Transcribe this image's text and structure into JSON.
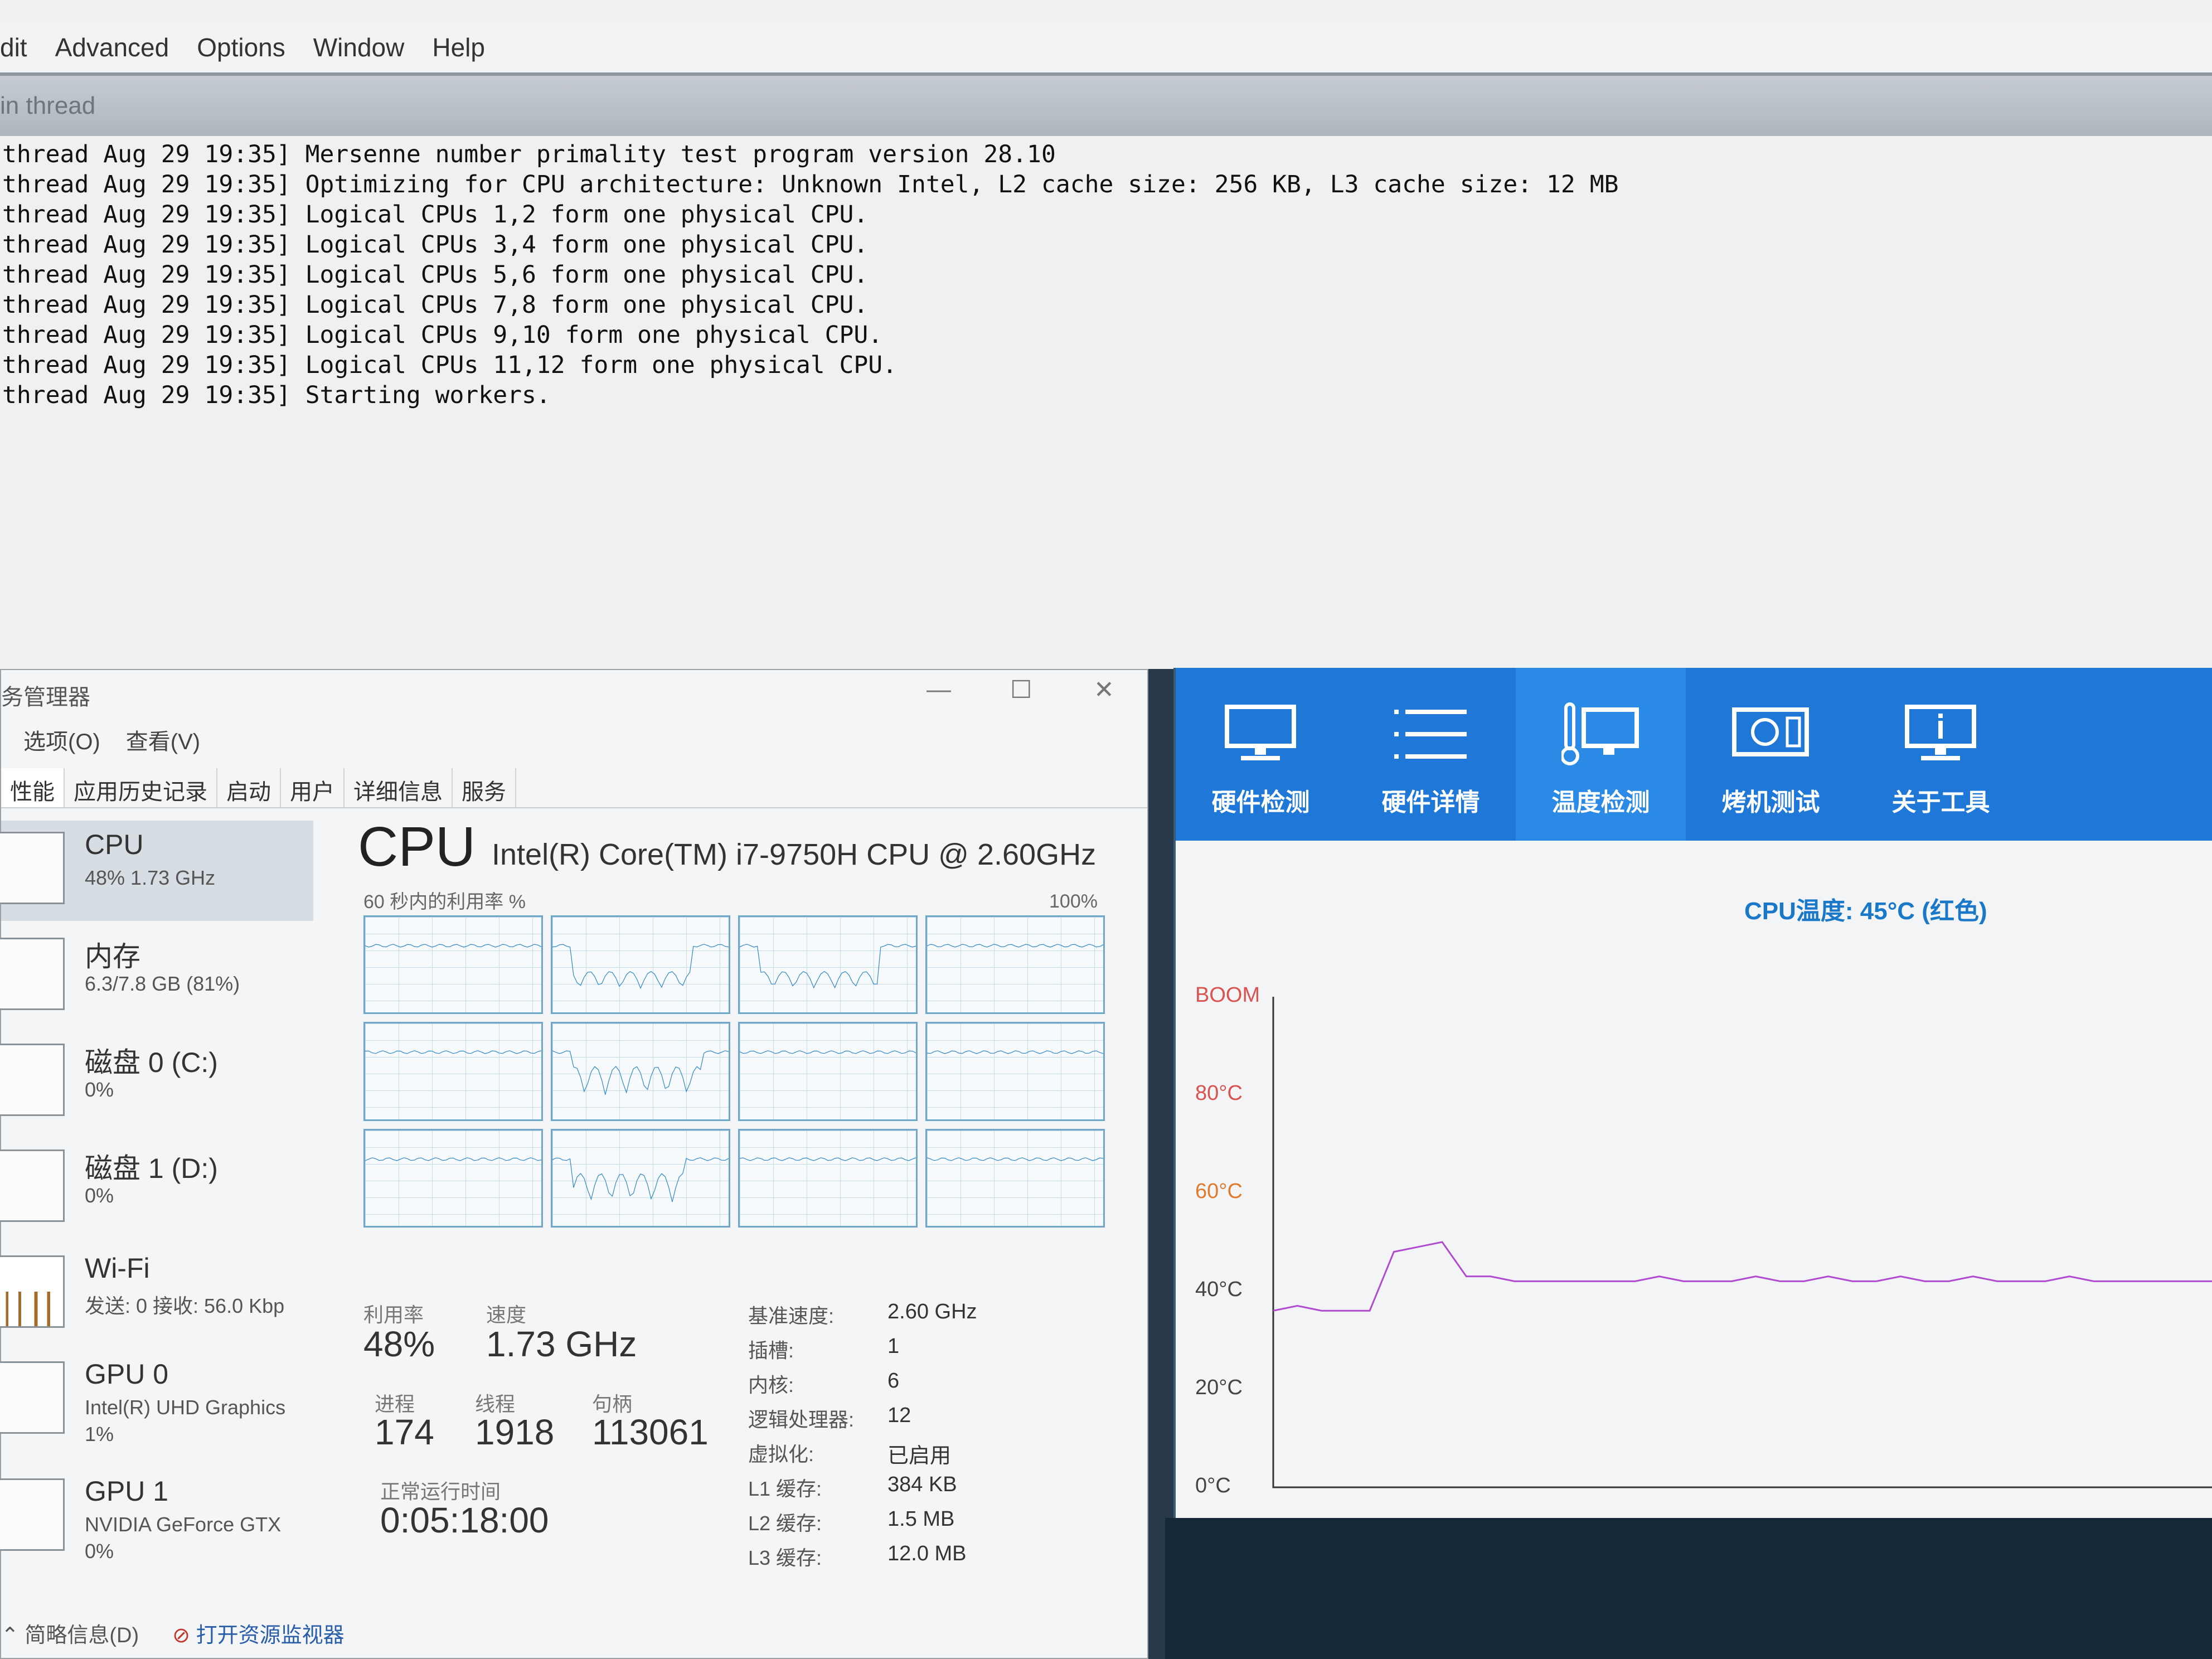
{
  "prime95": {
    "menu": [
      "dit",
      "Advanced",
      "Options",
      "Window",
      "Help"
    ],
    "window_title": "in thread",
    "log": [
      "thread Aug 29 19:35] Mersenne number primality test program version 28.10",
      "thread Aug 29 19:35] Optimizing for CPU architecture: Unknown Intel, L2 cache size: 256 KB, L3 cache size: 12 MB",
      "thread Aug 29 19:35] Logical CPUs 1,2 form one physical CPU.",
      "thread Aug 29 19:35] Logical CPUs 3,4 form one physical CPU.",
      "thread Aug 29 19:35] Logical CPUs 5,6 form one physical CPU.",
      "thread Aug 29 19:35] Logical CPUs 7,8 form one physical CPU.",
      "thread Aug 29 19:35] Logical CPUs 9,10 form one physical CPU.",
      "thread Aug 29 19:35] Logical CPUs 11,12 form one physical CPU.",
      "thread Aug 29 19:35] Starting workers."
    ]
  },
  "taskmgr": {
    "title": "务管理器",
    "win_controls": {
      "minimize": "—",
      "maximize": "☐",
      "close": "✕"
    },
    "menus": [
      "选项(O)",
      "查看(V)"
    ],
    "tabs": [
      "性能",
      "应用历史记录",
      "启动",
      "用户",
      "详细信息",
      "服务"
    ],
    "sidebar": [
      {
        "name": "CPU",
        "sub": "48% 1.73 GHz",
        "sub2": ""
      },
      {
        "name": "内存",
        "sub": "6.3/7.8 GB (81%)",
        "sub2": ""
      },
      {
        "name": "磁盘 0 (C:)",
        "sub": "0%",
        "sub2": ""
      },
      {
        "name": "磁盘 1 (D:)",
        "sub": "0%",
        "sub2": ""
      },
      {
        "name": "Wi-Fi",
        "sub": "发送: 0 接收: 56.0 Kbp",
        "sub2": ""
      },
      {
        "name": "GPU 0",
        "sub": "Intel(R) UHD Graphics",
        "sub2": "1%"
      },
      {
        "name": "GPU 1",
        "sub": "NVIDIA GeForce GTX",
        "sub2": "0%"
      }
    ],
    "cpu_title": "CPU",
    "cpu_model": "Intel(R) Core(TM) i7-9750H CPU @ 2.60GHz",
    "util_label": "60 秒内的利用率 %",
    "util_max": "100%",
    "stats": {
      "util_label": "利用率",
      "util": "48%",
      "speed_label": "速度",
      "speed": "1.73 GHz",
      "proc_label": "进程",
      "proc": "174",
      "threads_label": "线程",
      "threads": "1918",
      "handles_label": "句柄",
      "handles": "113061",
      "uptime_label": "正常运行时间",
      "uptime": "0:05:18:00"
    },
    "specs": [
      {
        "k": "基准速度:",
        "v": "2.60 GHz"
      },
      {
        "k": "插槽:",
        "v": "1"
      },
      {
        "k": "内核:",
        "v": "6"
      },
      {
        "k": "逻辑处理器:",
        "v": "12"
      },
      {
        "k": "虚拟化:",
        "v": "已启用"
      },
      {
        "k": "L1 缓存:",
        "v": "384 KB"
      },
      {
        "k": "L2 缓存:",
        "v": "1.5 MB"
      },
      {
        "k": "L3 缓存:",
        "v": "12.0 MB"
      }
    ],
    "footer": {
      "summary": "简略信息(D)",
      "resmon": "打开资源监视器"
    }
  },
  "temp_tool": {
    "buttons": [
      "硬件检测",
      "硬件详情",
      "温度检测",
      "烤机测试",
      "关于工具"
    ],
    "active_index": 2,
    "current": "CPU温度: 45°C (红色)",
    "y_labels": [
      {
        "text": "BOOM",
        "color": "#d9534f"
      },
      {
        "text": "80°C",
        "color": "#d9534f"
      },
      {
        "text": "60°C",
        "color": "#e07b2e"
      },
      {
        "text": "40°C",
        "color": "#444444"
      },
      {
        "text": "20°C",
        "color": "#444444"
      },
      {
        "text": "0°C",
        "color": "#444444"
      }
    ],
    "line_color": "#b04bd0",
    "temps": [
      36,
      37,
      36,
      36,
      36,
      48,
      49,
      50,
      43,
      43,
      42,
      42,
      42,
      42,
      42,
      42,
      43,
      42,
      42,
      42,
      43,
      42,
      42,
      43,
      42,
      42,
      43,
      42,
      42,
      43,
      42,
      42,
      42,
      43,
      42,
      42,
      42,
      42,
      42,
      42
    ]
  }
}
